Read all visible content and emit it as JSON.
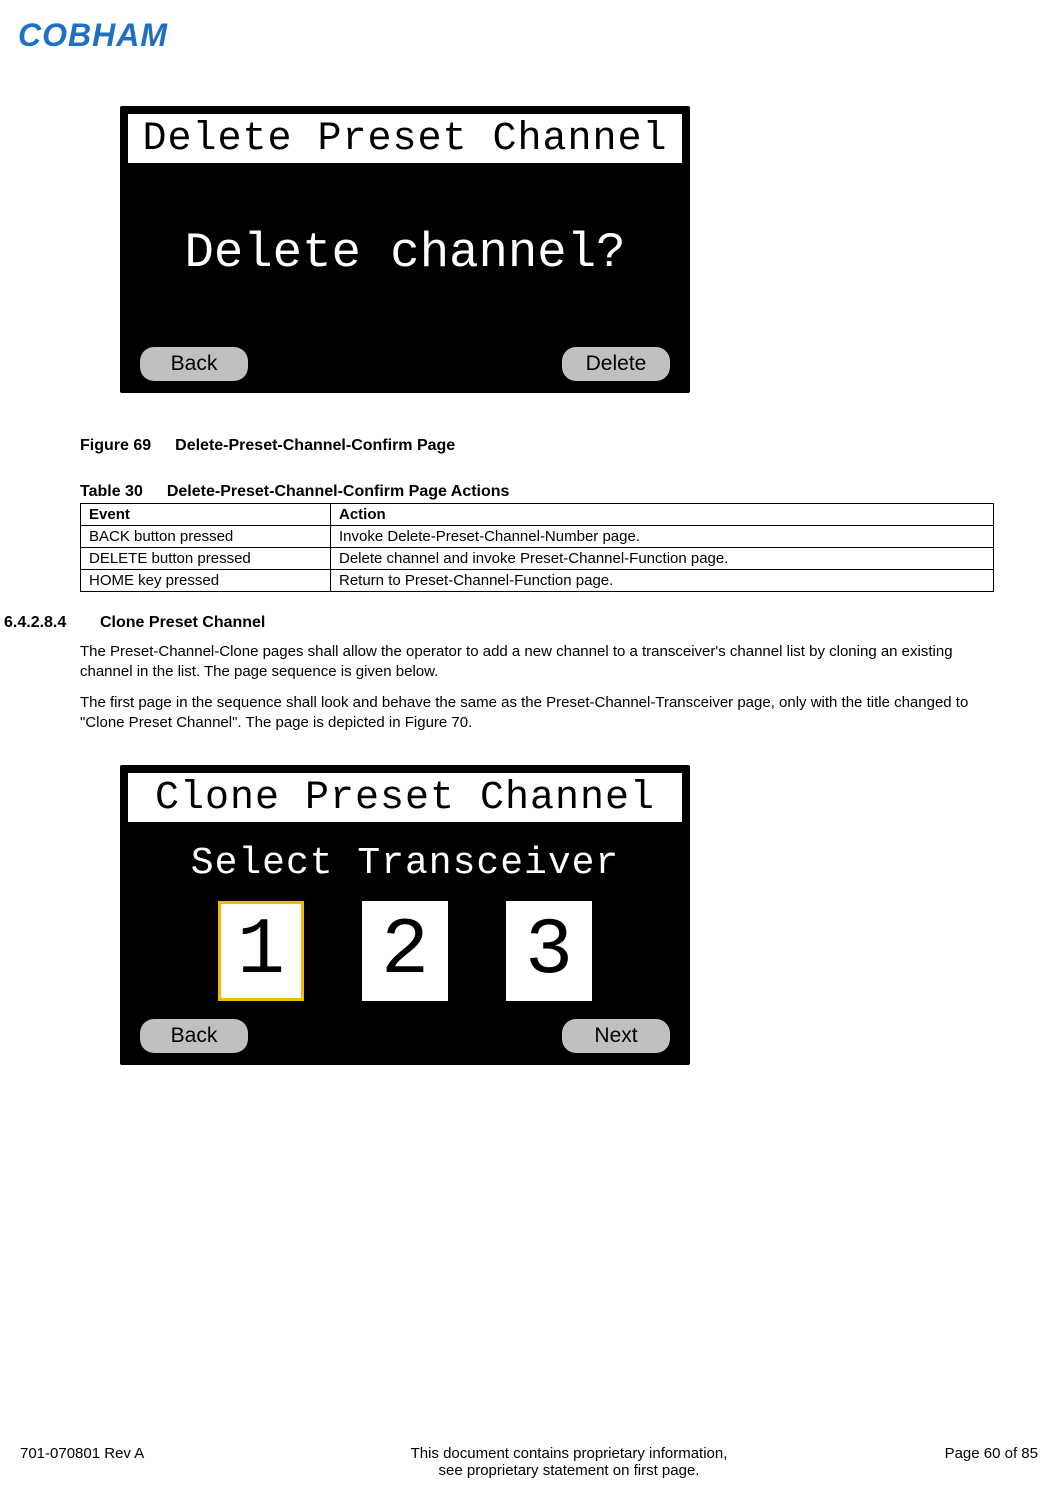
{
  "logo_text": "COBHAM",
  "figure1": {
    "screen_title": "Delete Preset Channel",
    "prompt": "Delete channel?",
    "back_label": "Back",
    "delete_label": "Delete",
    "caption_num": "Figure 69",
    "caption_text": "Delete-Preset-Channel-Confirm Page"
  },
  "table30": {
    "caption_num": "Table 30",
    "caption_text": "Delete-Preset-Channel-Confirm Page Actions",
    "headers": {
      "event": "Event",
      "action": "Action"
    },
    "rows": [
      {
        "event": "BACK button pressed",
        "action": "Invoke Delete-Preset-Channel-Number page."
      },
      {
        "event": "DELETE button pressed",
        "action": "Delete channel and invoke Preset-Channel-Function page."
      },
      {
        "event": "HOME key pressed",
        "action": "Return to Preset-Channel-Function page."
      }
    ]
  },
  "section": {
    "number": "6.4.2.8.4",
    "title": "Clone Preset Channel",
    "para1": "The Preset-Channel-Clone pages shall allow the operator to add a new channel to a transceiver's channel list by cloning an existing channel in the list.  The page sequence is given below.",
    "para2": "The first page in the sequence shall look and behave the same as the Preset-Channel-Transceiver page, only with the title changed to \"Clone Preset Channel\".  The page is depicted in Figure 70."
  },
  "figure2": {
    "screen_title": "Clone Preset Channel",
    "select_label": "Select Transceiver",
    "options": [
      "1",
      "2",
      "3"
    ],
    "selected_index": 0,
    "back_label": "Back",
    "next_label": "Next"
  },
  "footer": {
    "left": "701-070801 Rev A",
    "center_line1": "This document contains proprietary information,",
    "center_line2": "see proprietary statement on first page.",
    "right": "Page 60 of 85"
  }
}
